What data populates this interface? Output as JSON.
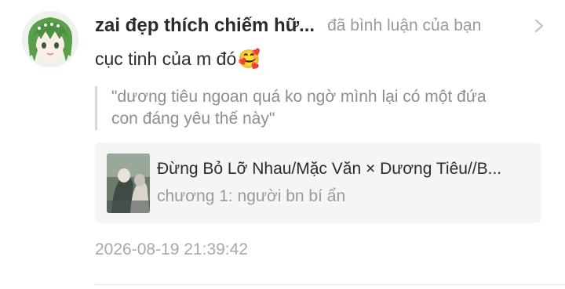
{
  "notification": {
    "username": "zai đẹp thích chiếm hữ...",
    "action": "đã bình luận của bạn",
    "comment_text": "cục tinh của m đó",
    "emoji": "🥰",
    "quoted_comment": {
      "line1": "\"dương tiêu ngoan quá ko ngờ mình lại có một đứa",
      "line2": "con đáng yêu thế này\""
    },
    "story": {
      "title": "Đừng Bỏ Lỡ Nhau/Mặc Văn × Dương Tiêu//B...",
      "chapter": "chương 1: người bn bí ẩn"
    },
    "timestamp": "2026-08-19 21:39:42"
  },
  "icons": {
    "avatar": "avatar-anime-green-hair",
    "chevron": "chevron-right-icon",
    "cover": "story-cover-image"
  },
  "colors": {
    "username": "#2b2b2b",
    "muted": "#9a9a9a",
    "card_bg": "#f5f5f5",
    "avatar_hair": "#5aa04a"
  }
}
